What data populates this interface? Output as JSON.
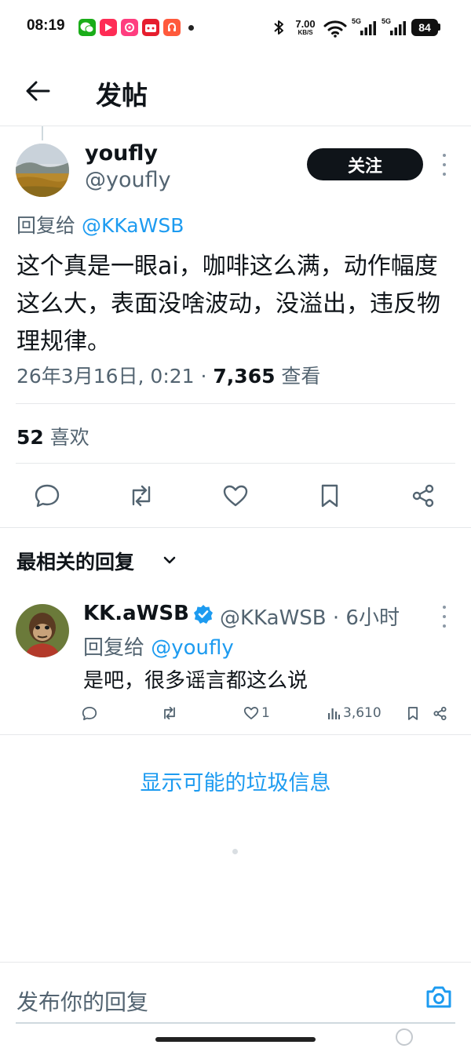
{
  "status_bar": {
    "time": "08:19",
    "apps": [
      {
        "name": "wechat-icon",
        "color": "#1aad19",
        "glyph": "✆"
      },
      {
        "name": "video-app-icon",
        "color": "#fe2c55",
        "glyph": "▶"
      },
      {
        "name": "shopping-app-icon",
        "color": "#ff3d7f",
        "glyph": "✿"
      },
      {
        "name": "tmall-icon",
        "color": "#e61e2e",
        "glyph": "◉"
      },
      {
        "name": "listen-app-icon",
        "color": "#ff5a3c",
        "glyph": "听"
      }
    ],
    "net_speed_value": "7.00",
    "net_speed_unit": "KB/S",
    "signal1_label": "5G",
    "signal2_label": "5G",
    "battery": "84"
  },
  "header": {
    "title": "发帖"
  },
  "post": {
    "display_name": "youfly",
    "handle": "@youfly",
    "follow_label": "关注",
    "reply_to_prefix": "回复给 ",
    "reply_to_handle": "@KKaWSB",
    "text": "这个真是一眼ai，咖啡这么满，动作幅度这么大，表面没啥波动，没溢出，违反物理规律。",
    "timestamp": "26年3月16日, 0:21 · ",
    "views_count": "7,365",
    "views_label": " 查看",
    "likes_count": "52",
    "likes_label": " 喜欢"
  },
  "replies_section": {
    "sort_label": "最相关的回复"
  },
  "reply": {
    "display_name": "KK.aWSB",
    "handle_time": "@KKaWSB · 6小时",
    "reply_to_prefix": "回复给 ",
    "reply_to_handle": "@youfly",
    "text": "是吧，很多谣言都这么说",
    "like_count": "1",
    "view_count": "3,610"
  },
  "spam_link": "显示可能的垃圾信息",
  "composer": {
    "placeholder": "发布你的回复"
  },
  "colors": {
    "accent": "#1d9bf0",
    "text": "#0f1419",
    "secondary": "#536471",
    "divider": "#e6e8ea"
  }
}
